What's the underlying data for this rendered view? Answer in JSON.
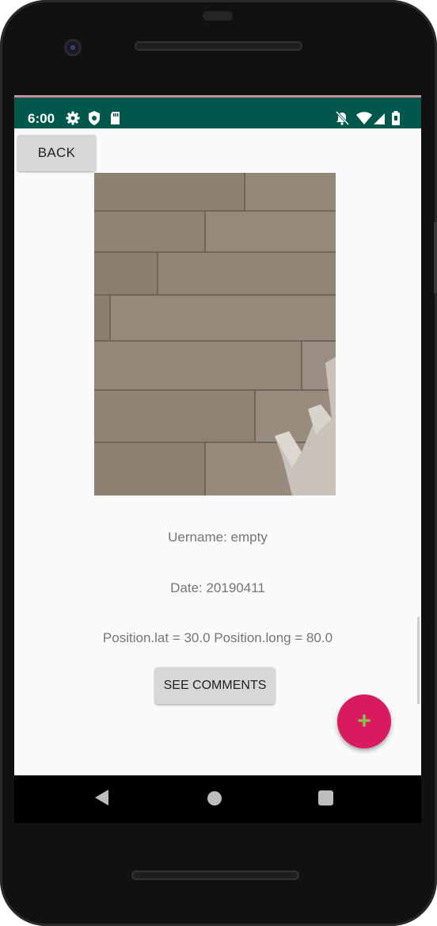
{
  "status_bar": {
    "time": "6:00",
    "left_icons": [
      "gear-icon",
      "shield-icon",
      "sd-card-icon"
    ],
    "right_icons": [
      "notifications-off-icon",
      "wifi-icon",
      "cell-signal-icon",
      "battery-icon"
    ],
    "background_color": "#00574b"
  },
  "toolbar": {
    "back_label": "BACK"
  },
  "photo": {
    "description_icon": "wooden-floor-photo"
  },
  "details": {
    "username": "Uername: empty",
    "date": "Date: 20190411",
    "position": "Position.lat = 30.0  Position.long = 80.0"
  },
  "actions": {
    "see_comments_label": "SEE COMMENTS",
    "fab_icon": "plus-icon",
    "fab_label": "+",
    "fab_color": "#d81b60",
    "fab_icon_color": "#8bc34a"
  },
  "nav_bar": {
    "icons": [
      "back-triangle-icon",
      "home-circle-icon",
      "recents-square-icon"
    ]
  }
}
